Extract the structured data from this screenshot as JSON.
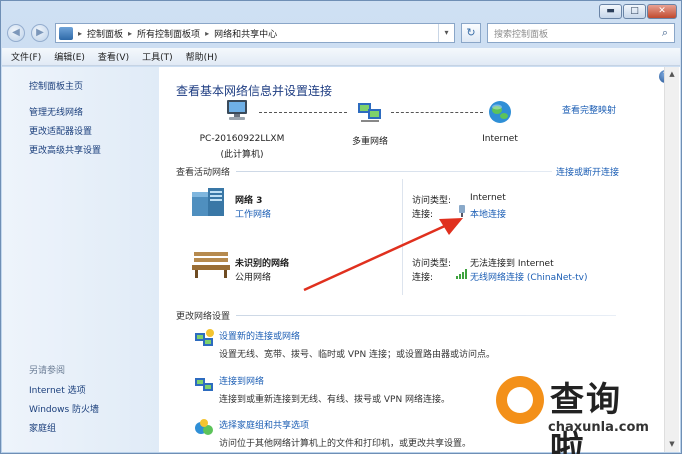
{
  "window": {
    "buttons": {
      "minimize": "▬",
      "maximize": "□",
      "close": "✕"
    }
  },
  "navbar": {
    "back": "◀",
    "forward": "▶",
    "breadcrumb": [
      "控制面板",
      "所有控制面板项",
      "网络和共享中心"
    ],
    "refresh": "↻",
    "search_placeholder": "搜索控制面板"
  },
  "menu": [
    "文件(F)",
    "编辑(E)",
    "查看(V)",
    "工具(T)",
    "帮助(H)"
  ],
  "sidebar": {
    "items": [
      "控制面板主页",
      "管理无线网络",
      "更改适配器设置",
      "更改高级共享设置"
    ],
    "see_also_title": "另请参阅",
    "see_also": [
      "Internet 选项",
      "Windows 防火墙",
      "家庭组"
    ]
  },
  "main": {
    "help": "?",
    "title": "查看基本网络信息并设置连接",
    "view_full_map": "查看完整映射",
    "map": {
      "pc_name": "PC-20160922LLXM",
      "pc_sub": "(此计算机)",
      "middle": "多重网络",
      "right": "Internet"
    },
    "active_title": "查看活动网络",
    "connect_link": "连接或断开连接",
    "networks": [
      {
        "name": "网络  3",
        "type": "工作网络",
        "access_label": "访问类型:",
        "access_value": "Internet",
        "conn_label": "连接:",
        "conn_value": "本地连接"
      },
      {
        "name": "未识别的网络",
        "type": "公用网络",
        "access_label": "访问类型:",
        "access_value": "无法连接到 Internet",
        "conn_label": "连接:",
        "conn_value": "无线网络连接 (ChinaNet-tv)"
      }
    ],
    "change_title": "更改网络设置",
    "tasks": [
      {
        "title": "设置新的连接或网络",
        "desc": "设置无线、宽带、拨号、临时或 VPN 连接；或设置路由器或访问点。"
      },
      {
        "title": "连接到网络",
        "desc": "连接到或重新连接到无线、有线、拨号或 VPN 网络连接。"
      },
      {
        "title": "选择家庭组和共享选项",
        "desc": "访问位于其他网络计算机上的文件和打印机，或更改共享设置。"
      }
    ]
  },
  "watermark": {
    "name": "查询啦",
    "url": "chaxunla.com"
  },
  "colors": {
    "link": "#1d5fb5",
    "title": "#1e3d82",
    "arrow": "#e0301e",
    "watermark_orange": "#f39019"
  }
}
